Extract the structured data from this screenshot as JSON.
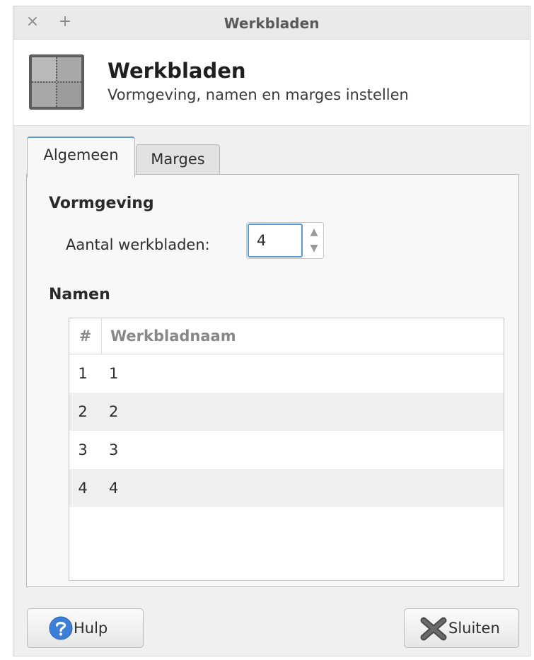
{
  "window": {
    "title": "Werkbladen",
    "close_icon": "×",
    "add_icon": "+"
  },
  "header": {
    "title": "Werkbladen",
    "subtitle": "Vormgeving, namen en marges instellen",
    "icon": "workspaces-icon"
  },
  "tabs": [
    {
      "label": "Algemeen",
      "active": true
    },
    {
      "label": "Marges",
      "active": false
    }
  ],
  "general": {
    "appearance_title": "Vormgeving",
    "count_label": "Aantal werkbladen:",
    "count_value": "4",
    "names_title": "Namen",
    "table": {
      "columns": [
        "#",
        "Werkbladnaam"
      ],
      "rows": [
        {
          "num": "1",
          "name": "1"
        },
        {
          "num": "2",
          "name": "2"
        },
        {
          "num": "3",
          "name": "3"
        },
        {
          "num": "4",
          "name": "4"
        }
      ]
    }
  },
  "buttons": {
    "help_label": "Hulp",
    "close_label": "Sluiten"
  },
  "colors": {
    "accent": "#5b9bd5",
    "help_icon": "#3d7fd6",
    "close_icon": "#4a4a4a"
  }
}
